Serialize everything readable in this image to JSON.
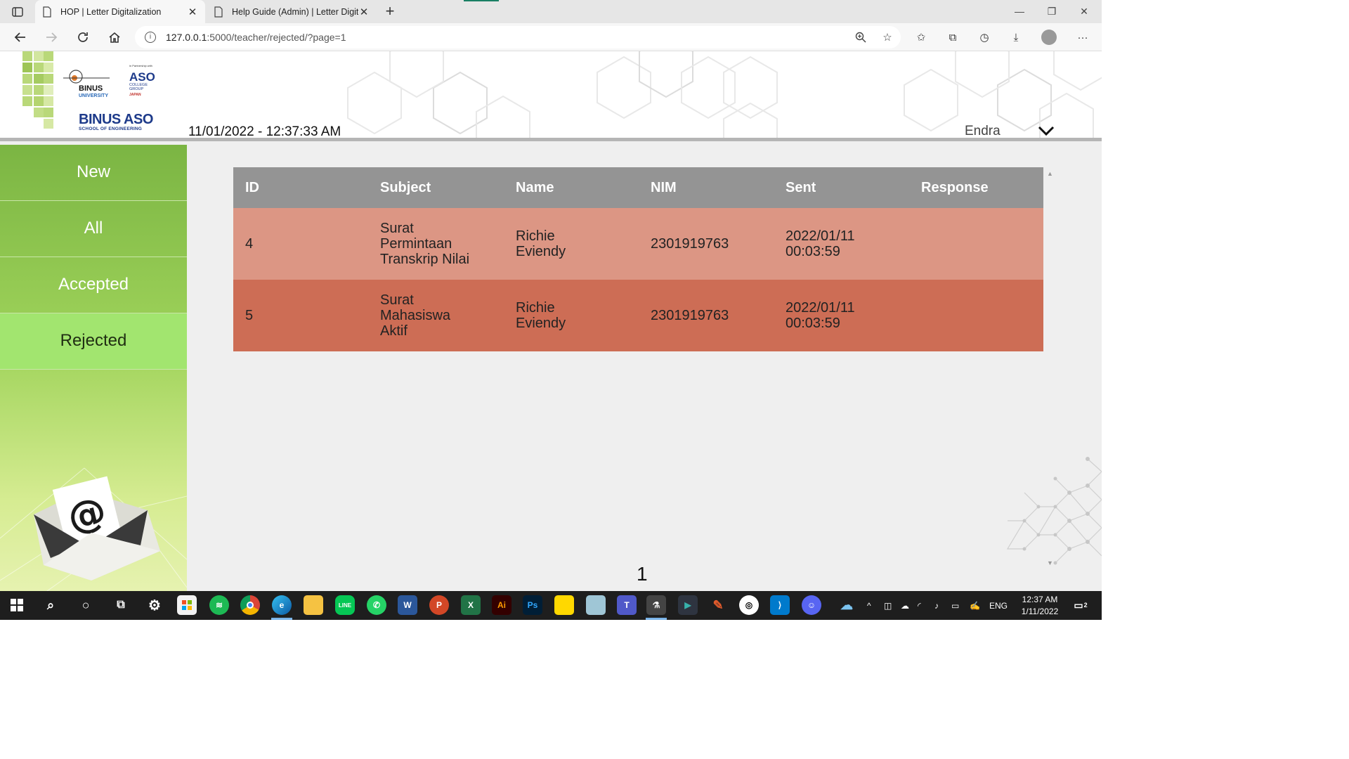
{
  "browser": {
    "tabs": [
      {
        "title": "HOP | Letter Digitalization",
        "active": true
      },
      {
        "title": "Help Guide (Admin) | Letter Digit",
        "active": false
      }
    ],
    "url_host": "127.0.0.1",
    "url_path": ":5000/teacher/rejected/?page=1"
  },
  "header": {
    "logo_binus_text": "BINUS UNIVERSITY",
    "logo_aso_text": "ASO",
    "binus_aso_title": "BINUS ASO",
    "binus_aso_sub": "SCHOOL OF ENGINEERING",
    "datetime": "11/01/2022 - 12:37:33 AM",
    "user": "Endra"
  },
  "sidebar": {
    "items": [
      {
        "label": "New",
        "active": false
      },
      {
        "label": "All",
        "active": false
      },
      {
        "label": "Accepted",
        "active": false
      },
      {
        "label": "Rejected",
        "active": true
      }
    ]
  },
  "table": {
    "columns": [
      "ID",
      "Subject",
      "Name",
      "NIM",
      "Sent",
      "Response"
    ],
    "rows": [
      {
        "id": "4",
        "subject": "Surat Permintaan Transkrip Nilai",
        "name": "Richie Eviendy",
        "nim": "2301919763",
        "sent": "2022/01/11 00:03:59",
        "response": ""
      },
      {
        "id": "5",
        "subject": "Surat Mahasiswa Aktif",
        "name": "Richie Eviendy",
        "nim": "2301919763",
        "sent": "2022/01/11 00:03:59",
        "response": ""
      }
    ]
  },
  "pagination": {
    "current_page": "1"
  },
  "taskbar": {
    "tray_lang": "ENG",
    "clock_time": "12:37 AM",
    "clock_date": "1/11/2022",
    "notification_count": "2"
  },
  "colors": {
    "sidebar_green": "#7bb543",
    "sidebar_active": "#a2e56f",
    "row_light": "#dc9684",
    "row_dark": "#cd6d55",
    "table_header": "#949494"
  }
}
